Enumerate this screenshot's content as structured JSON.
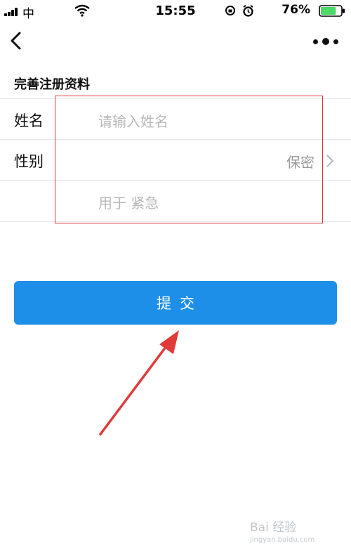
{
  "status_bar": {
    "carrier": "中",
    "time": "15:55",
    "battery_percent": "76%",
    "battery_level": 0.76,
    "battery_color": "#4cd964"
  },
  "nav": {
    "back_icon": "chevron-left-icon",
    "more_icon": "more-dots-icon"
  },
  "form": {
    "title": "完善注册资料",
    "rows": [
      {
        "label": "姓名",
        "placeholder": "请输入姓名"
      },
      {
        "label": "性别",
        "value": "保密"
      },
      {
        "label": "",
        "placeholder": "用于    紧急"
      }
    ]
  },
  "submit": {
    "label": "提交",
    "color": "#1e8fe8"
  },
  "annotation": {
    "box_color": "#d93a3a",
    "arrow_color": "#e03a3a"
  },
  "watermark": {
    "text": "Bai  经验",
    "sub": "jingyan.baidu.com"
  }
}
